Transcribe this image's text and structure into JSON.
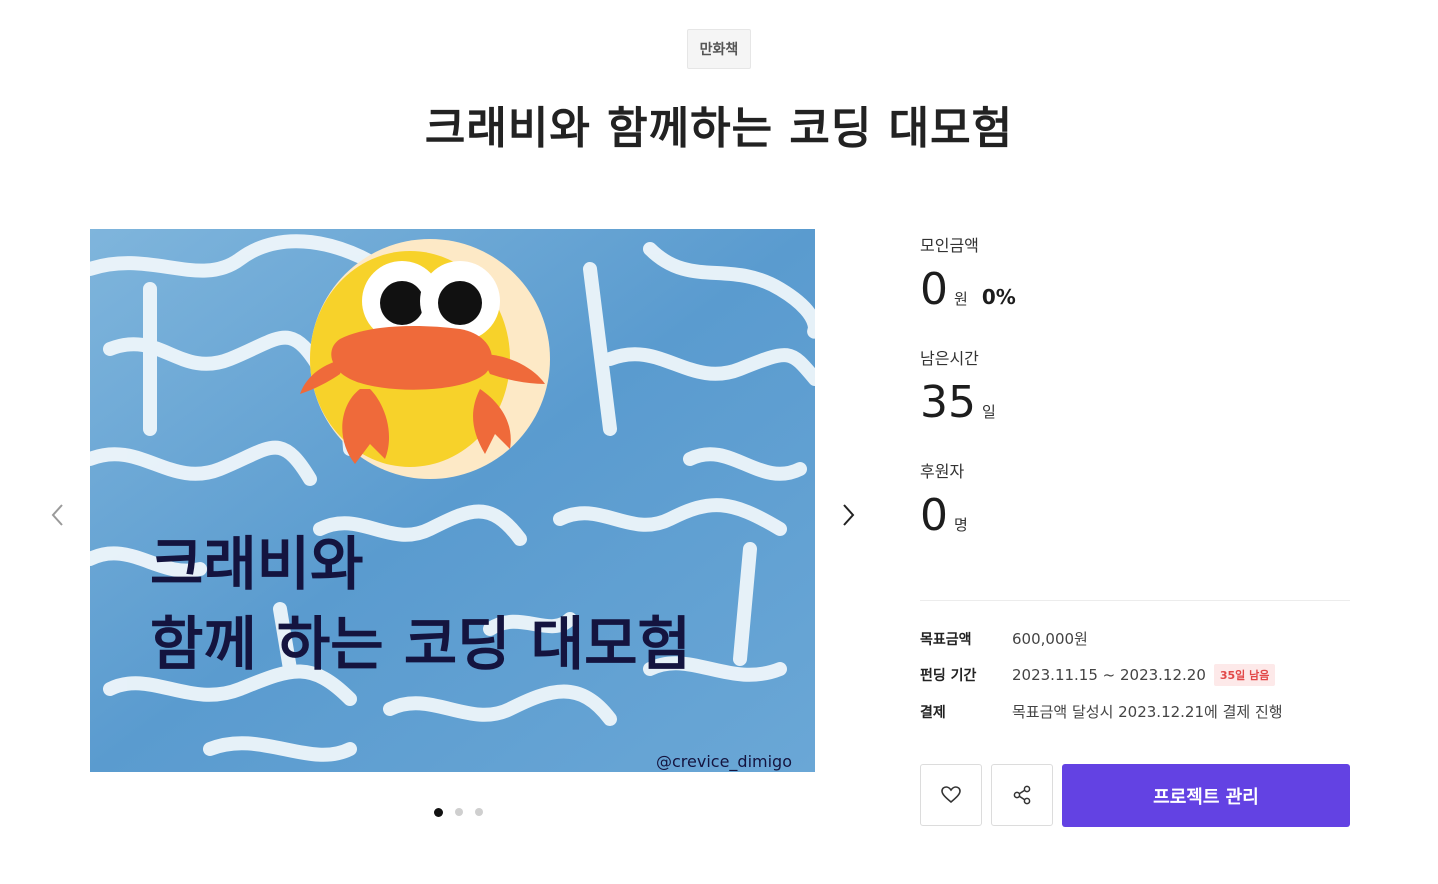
{
  "category": "만화책",
  "title": "크래비와 함께하는 코딩 대모험",
  "hero": {
    "text_line1": "크래비와",
    "text_line2": "함께 하는 코딩 대모험",
    "credit": "@crevice_dimigo",
    "slide_count": 3,
    "active_slide": 1
  },
  "stats": {
    "raised": {
      "label": "모인금액",
      "value": "0",
      "unit": "원",
      "percent": "0%"
    },
    "time_left": {
      "label": "남은시간",
      "value": "35",
      "unit": "일"
    },
    "backers": {
      "label": "후원자",
      "value": "0",
      "unit": "명"
    }
  },
  "info": {
    "goal": {
      "key": "목표금액",
      "value": "600,000원"
    },
    "period": {
      "key": "펀딩 기간",
      "value": "2023.11.15 ~ 2023.12.20",
      "badge": "35일 남음"
    },
    "payment": {
      "key": "결제",
      "value": "목표금액 달성시 2023.12.21에 결제 진행"
    }
  },
  "actions": {
    "manage_label": "프로젝트 관리"
  },
  "colors": {
    "accent": "#6342e3",
    "badge_text": "#e24848",
    "badge_bg": "#fde9e9"
  }
}
